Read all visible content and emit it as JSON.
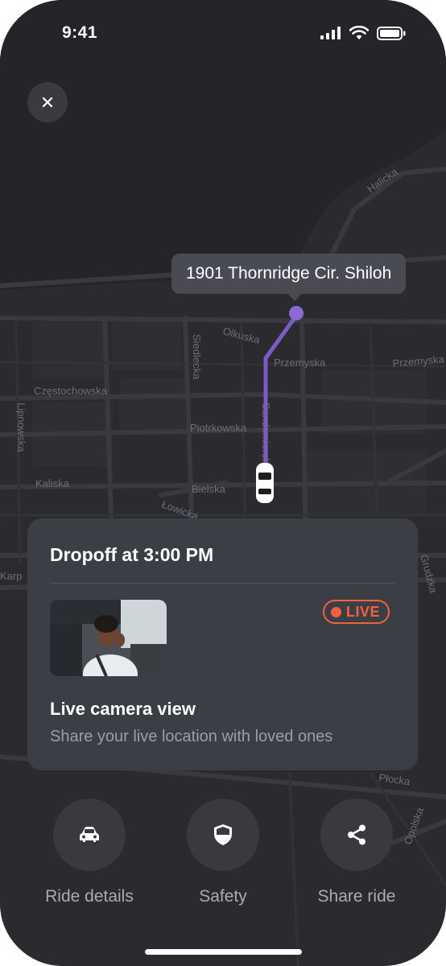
{
  "status_bar": {
    "time": "9:41"
  },
  "map": {
    "destination_label": "1901 Thornridge Cir. Shiloh",
    "streets": [
      "Halicka",
      "Olkuska",
      "Siedlecka",
      "Przemyska",
      "Przemyska",
      "Częstochowska",
      "Lipnowska",
      "Piotrkowska",
      "Kaliska",
      "Bielska",
      "Łowicka",
      "Karp",
      "Grudzka",
      "Płocka",
      "Opolska",
      "Sandomierska"
    ],
    "route_color": "#7b5cc4"
  },
  "card": {
    "title": "Dropoff at 3:00 PM",
    "live_badge": "LIVE",
    "camera_title": "Live camera view",
    "camera_subtitle": "Share your live location with loved ones",
    "accent_color": "#f0623f"
  },
  "actions": [
    {
      "label": "Ride details",
      "icon": "car-icon"
    },
    {
      "label": "Safety",
      "icon": "shield-icon"
    },
    {
      "label": "Share ride",
      "icon": "share-icon"
    }
  ]
}
